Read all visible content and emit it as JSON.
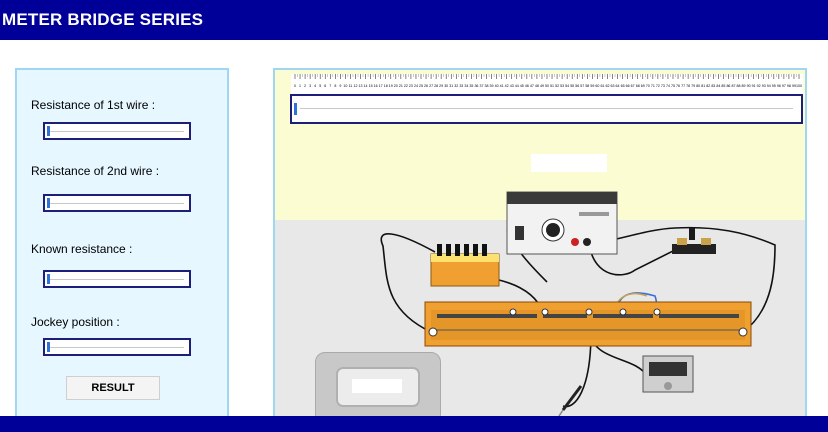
{
  "header": {
    "title": "METER BRIDGE SERIES"
  },
  "controls": {
    "r1_label": "Resistance of 1st wire :",
    "r2_label": "Resistance of 2nd wire :",
    "known_label": "Known resistance :",
    "jockey_label": "Jockey position :",
    "result_label": "RESULT"
  },
  "ruler": {
    "tick_labels": [
      "0",
      "1",
      "2",
      "3",
      "4",
      "5",
      "6",
      "7",
      "8",
      "9",
      "10",
      "11",
      "12",
      "13",
      "14",
      "15",
      "16",
      "17",
      "18",
      "19",
      "20",
      "21",
      "22",
      "23",
      "24",
      "25",
      "26",
      "27",
      "28",
      "29",
      "30",
      "31",
      "32",
      "33",
      "34",
      "35",
      "36",
      "37",
      "38",
      "39",
      "40",
      "41",
      "42",
      "43",
      "44",
      "45",
      "46",
      "47",
      "48",
      "49",
      "50",
      "51",
      "52",
      "53",
      "54",
      "55",
      "56",
      "57",
      "58",
      "59",
      "60",
      "61",
      "62",
      "63",
      "64",
      "65",
      "66",
      "67",
      "68",
      "69",
      "70",
      "71",
      "72",
      "73",
      "74",
      "75",
      "76",
      "77",
      "78",
      "79",
      "80",
      "81",
      "82",
      "83",
      "84",
      "85",
      "86",
      "87",
      "88",
      "89",
      "90",
      "91",
      "92",
      "93",
      "94",
      "95",
      "96",
      "97",
      "98",
      "99",
      "100"
    ]
  },
  "colors": {
    "header": "#000099",
    "panel_bg": "#e6f7ff",
    "panel_border": "#9fd6f2",
    "slider_border": "#1d1d7a",
    "thumb": "#2f73d8",
    "bridge_board": "#f0a030"
  }
}
